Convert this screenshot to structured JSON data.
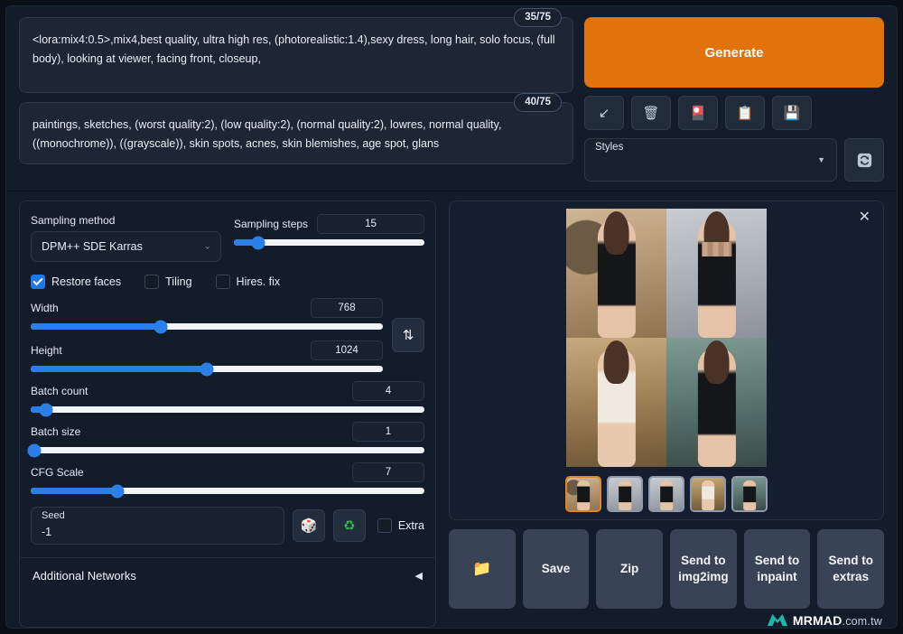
{
  "prompt": {
    "positive_text": "<lora:mix4:0.5>,mix4,best quality, ultra high res, (photorealistic:1.4),sexy dress, long hair, solo focus, (full body), looking at viewer, facing front, closeup,",
    "positive_counter": "35/75",
    "negative_text": "paintings, sketches, (worst quality:2), (low quality:2), (normal quality:2), lowres, normal quality, ((monochrome)), ((grayscale)), skin spots, acnes, skin blemishes, age spot, glans",
    "negative_counter": "40/75"
  },
  "generate": {
    "label": "Generate",
    "color": "#e2720a"
  },
  "toolbar": {
    "buttons": [
      {
        "name": "restore-progress-button",
        "icon": "↙"
      },
      {
        "name": "clear-prompt-button",
        "icon": "🗑"
      },
      {
        "name": "read-generation-params-button",
        "icon": "🎴"
      },
      {
        "name": "apply-style-button",
        "icon": "📋"
      },
      {
        "name": "save-style-button",
        "icon": "💾"
      }
    ]
  },
  "styles": {
    "label": "Styles",
    "value": "",
    "caret": "▼",
    "refresh_icon": "🔄"
  },
  "settings": {
    "sampling_method": {
      "label": "Sampling method",
      "value": "DPM++ SDE Karras",
      "caret": "⌄"
    },
    "sampling_steps": {
      "label": "Sampling steps",
      "value": "15",
      "percent": 13
    },
    "checkboxes": [
      {
        "label": "Restore faces",
        "checked": true
      },
      {
        "label": "Tiling",
        "checked": false
      },
      {
        "label": "Hires. fix",
        "checked": false
      }
    ],
    "width": {
      "label": "Width",
      "value": "768",
      "percent": 37
    },
    "height": {
      "label": "Height",
      "value": "1024",
      "percent": 50
    },
    "swap_icon": "⇅",
    "batch_count": {
      "label": "Batch count",
      "value": "4",
      "percent": 4
    },
    "batch_size": {
      "label": "Batch size",
      "value": "1",
      "percent": 1
    },
    "cfg_scale": {
      "label": "CFG Scale",
      "value": "7",
      "percent": 22
    },
    "seed": {
      "label": "Seed",
      "value": "-1",
      "dice_icon": "🎲",
      "recycle_icon": "♻",
      "extra_label": "Extra",
      "extra_checked": false
    },
    "additional_networks": {
      "label": "Additional Networks",
      "toggle_icon": "◀"
    }
  },
  "results": {
    "close_icon": "✕",
    "images": [
      {
        "name": "result-image-1",
        "alt": "woman in black gown in corridor"
      },
      {
        "name": "result-image-2",
        "alt": "woman in black bodysuit, censored"
      },
      {
        "name": "result-image-3",
        "alt": "woman in white dress in hallway"
      },
      {
        "name": "result-image-4",
        "alt": "woman in black dress by green door"
      }
    ],
    "thumbnails": [
      {
        "name": "thumbnail-1",
        "selected": true
      },
      {
        "name": "thumbnail-2",
        "selected": false
      },
      {
        "name": "thumbnail-3",
        "selected": false
      },
      {
        "name": "thumbnail-4",
        "selected": false
      },
      {
        "name": "thumbnail-5",
        "selected": false
      }
    ],
    "actions": [
      {
        "name": "open-folder-button",
        "label": "📁"
      },
      {
        "name": "save-button",
        "label": "Save"
      },
      {
        "name": "zip-button",
        "label": "Zip"
      },
      {
        "name": "send-to-img2img-button",
        "label": "Send to img2img"
      },
      {
        "name": "send-to-inpaint-button",
        "label": "Send to inpaint"
      },
      {
        "name": "send-to-extras-button",
        "label": "Send to extras"
      }
    ]
  },
  "watermark": {
    "brand": "MRMAD",
    "domain": ".com.tw",
    "logo_color": "#1fb6a8"
  }
}
